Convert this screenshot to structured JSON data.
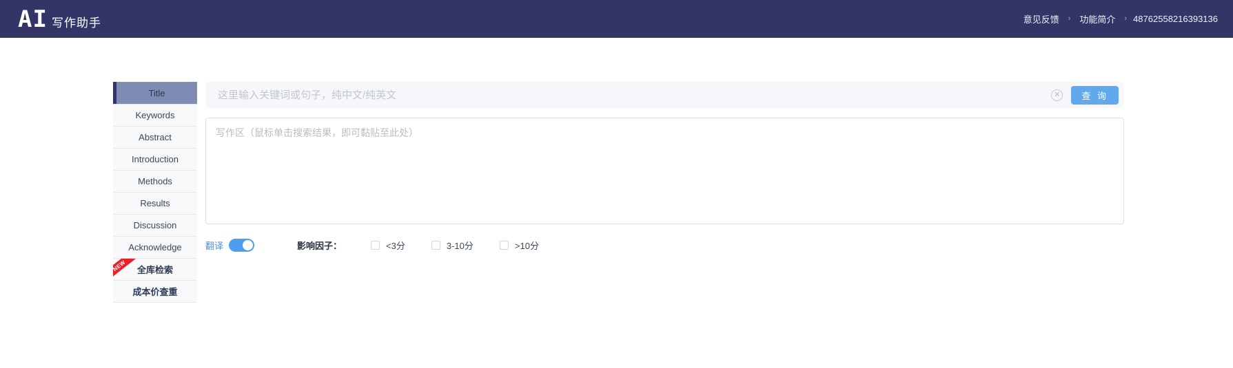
{
  "header": {
    "brand_ai": "AI",
    "brand_cn": "写作助手",
    "nav": [
      {
        "label": "意见反馈"
      },
      {
        "label": "功能简介"
      }
    ],
    "separator": "›",
    "user_id": "48762558216393136"
  },
  "sidebar": {
    "items": [
      {
        "label": "Title",
        "active": true,
        "badge": "",
        "bold": false
      },
      {
        "label": "Keywords",
        "active": false,
        "badge": "",
        "bold": false
      },
      {
        "label": "Abstract",
        "active": false,
        "badge": "",
        "bold": false
      },
      {
        "label": "Introduction",
        "active": false,
        "badge": "",
        "bold": false
      },
      {
        "label": "Methods",
        "active": false,
        "badge": "",
        "bold": false
      },
      {
        "label": "Results",
        "active": false,
        "badge": "",
        "bold": false
      },
      {
        "label": "Discussion",
        "active": false,
        "badge": "",
        "bold": false
      },
      {
        "label": "Acknowledge",
        "active": false,
        "badge": "",
        "bold": false
      },
      {
        "label": "全库检索",
        "active": false,
        "badge": "NEW",
        "bold": true
      },
      {
        "label": "成本价查重",
        "active": false,
        "badge": "",
        "bold": true
      }
    ]
  },
  "search": {
    "value": "",
    "placeholder": "这里输入关键词或句子，纯中文/纯英文",
    "clear_icon": "close-circle-icon",
    "button_label": "查 询"
  },
  "editor": {
    "value": "",
    "placeholder": "写作区（鼠标单击搜索结果，即可黏贴至此处）"
  },
  "options": {
    "translate_label": "翻译",
    "translate_on": true,
    "factor_label": "影响因子：",
    "factors": [
      {
        "label": "<3分",
        "checked": false
      },
      {
        "label": "3-10分",
        "checked": false
      },
      {
        "label": ">10分",
        "checked": false
      }
    ]
  },
  "colors": {
    "header_bg": "#333566",
    "accent_blue": "#62a8ed",
    "active_item_bg": "#7e8cb4",
    "badge_red": "#e8202a"
  }
}
